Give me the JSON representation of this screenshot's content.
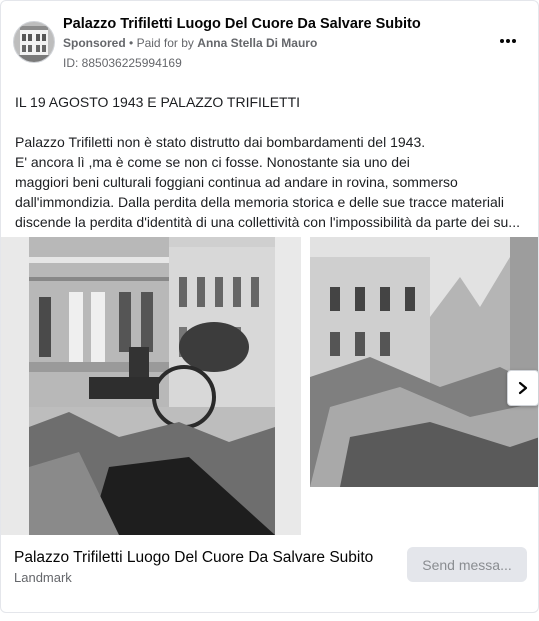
{
  "header": {
    "page_name": "Palazzo Trifiletti Luogo Del Cuore Da Salvare Subito",
    "sponsored": "Sponsored",
    "separator": "•",
    "paid_for_by": "Paid for by",
    "advertiser": "Anna Stella Di Mauro",
    "ad_id": "ID: 885036225994169",
    "more_icon": "more-horizontal-icon"
  },
  "post": {
    "headline": "IL 19 AGOSTO 1943 E PALAZZO TRIFILETTI",
    "lines": [
      "Palazzo Trifiletti non è stato distrutto dai bombardamenti del 1943.",
      "E' ancora lì ,ma è come se non ci fosse. Nonostante sia uno dei",
      "maggiori beni culturali foggiani continua ad andare in rovina, sommerso",
      "dall'immondizia. Dalla perdita della memoria storica e delle sue tracce materiali",
      "discende la perdita d'identità di una collettività con l'impossibilità da parte dei su..."
    ]
  },
  "carousel": {
    "next_icon": "chevron-right-icon"
  },
  "footer": {
    "title": "Palazzo Trifiletti Luogo Del Cuore Da Salvare Subito",
    "subtitle": "Landmark",
    "cta_label": "Send messa..."
  },
  "colors": {
    "text_primary": "#050505",
    "text_secondary": "#65676b",
    "button_bg": "#e4e6eb",
    "button_text": "#8a8d91",
    "border": "#e4e6eb"
  }
}
